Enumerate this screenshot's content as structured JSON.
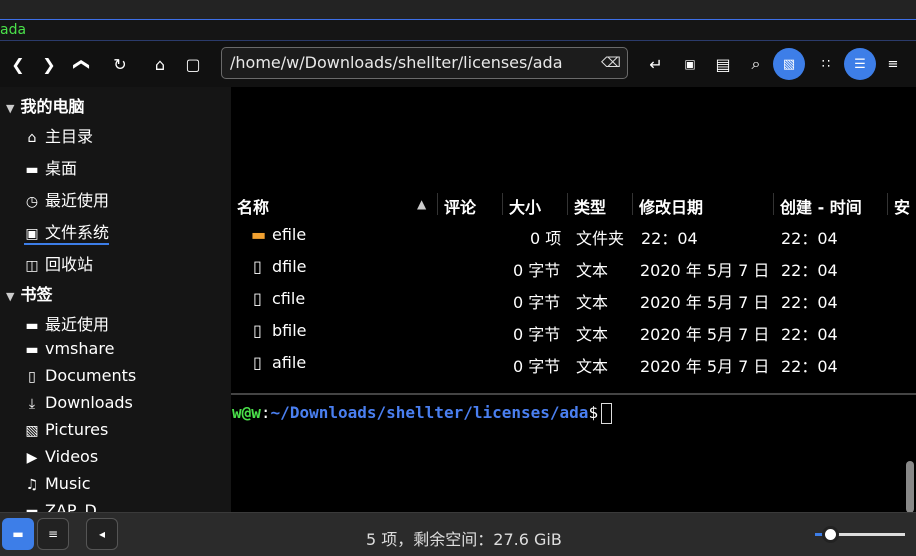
{
  "window": {
    "title": "ada"
  },
  "toolbar": {
    "path": "/home/w/Downloads/shellter/licenses/ada",
    "icons": [
      "chevron-left-icon",
      "chevron-right-icon",
      "chevron-up-icon",
      "reload-icon",
      "home-icon",
      "computer-icon",
      "clear-icon",
      "open-with-icon",
      "terminal-icon",
      "new-folder-icon",
      "search-icon",
      "image-preview-icon",
      "grid-view-icon",
      "detail-view-icon",
      "compact-view-icon"
    ]
  },
  "sidebar": {
    "computer_header": "我的电脑",
    "computer_items": [
      {
        "label": "主目录",
        "icon": "home-icon"
      },
      {
        "label": "桌面",
        "icon": "folder-icon"
      },
      {
        "label": "最近使用",
        "icon": "clock-icon"
      },
      {
        "label": "文件系统",
        "icon": "drive-icon"
      },
      {
        "label": "回收站",
        "icon": "trash-icon"
      }
    ],
    "bookmarks_header": "书签",
    "bookmark_items": [
      {
        "label": "最近使用",
        "icon": "recent-folder-icon"
      },
      {
        "label": "vmshare",
        "icon": "folder-icon"
      },
      {
        "label": "Documents",
        "icon": "document-icon"
      },
      {
        "label": "Downloads",
        "icon": "download-icon"
      },
      {
        "label": "Pictures",
        "icon": "camera-icon"
      },
      {
        "label": "Videos",
        "icon": "video-icon"
      },
      {
        "label": "Music",
        "icon": "music-icon"
      },
      {
        "label": "ZAP_D",
        "icon": "folder-icon"
      }
    ]
  },
  "files": {
    "columns": {
      "name": "名称",
      "comment": "评论",
      "size": "大小",
      "type": "类型",
      "modified": "修改日期",
      "created": "创建 - 时间",
      "extra": "安"
    },
    "rows": [
      {
        "name": "efile",
        "size": "0 项",
        "type": "文件夹",
        "modified": "22：04",
        "created": "22：04",
        "icon": "folder-icon"
      },
      {
        "name": "dfile",
        "size": "0 字节",
        "type": "文本",
        "modified": "2020 年 5月 7 日",
        "created": "22：04",
        "icon": "file-icon"
      },
      {
        "name": "cfile",
        "size": "0 字节",
        "type": "文本",
        "modified": "2020 年 5月 7 日",
        "created": "22：04",
        "icon": "file-icon"
      },
      {
        "name": "bfile",
        "size": "0 字节",
        "type": "文本",
        "modified": "2020 年 5月 7 日",
        "created": "22：04",
        "icon": "file-icon"
      },
      {
        "name": "afile",
        "size": "0 字节",
        "type": "文本",
        "modified": "2020 年 5月 7 日",
        "created": "22：04",
        "icon": "file-icon"
      }
    ]
  },
  "terminal": {
    "user": "w@w",
    "sep": ":",
    "cwd": "~/Downloads/shellter/licenses/ada",
    "symbol": "$"
  },
  "status": {
    "text": "5 项，剩余空间：27.6 GiB",
    "zoom_fraction": 0.1
  },
  "colors": {
    "accent": "#3d7ee8",
    "prompt_user": "#4ae04a",
    "prompt_path": "#4a7ff0"
  }
}
